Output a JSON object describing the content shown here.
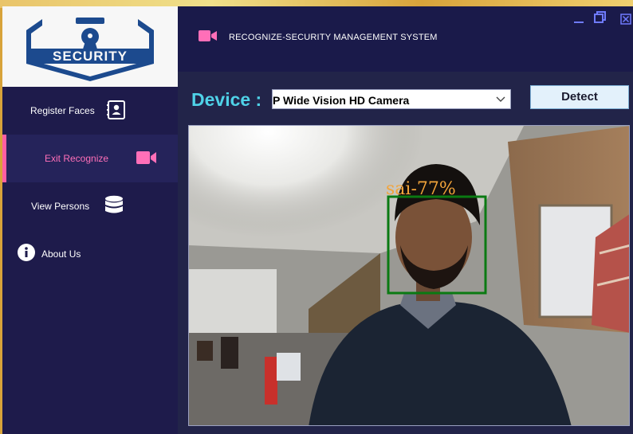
{
  "app": {
    "title": "RECOGNIZE-SECURITY MANAGEMENT SYSTEM",
    "logo_text": "SECURITY"
  },
  "sidebar": {
    "items": [
      {
        "label": "Register Faces",
        "icon": "contact-book-icon"
      },
      {
        "label": "Exit Recognize",
        "icon": "video-camera-icon",
        "active": true
      },
      {
        "label": "View Persons",
        "icon": "database-icon"
      },
      {
        "label": "About Us",
        "icon": "info-icon"
      }
    ]
  },
  "toolbar": {
    "device_label": "Device :",
    "device_value": "P Wide Vision HD Camera",
    "detect_label": "Detect"
  },
  "feed": {
    "recognition_label": "sai-77%"
  },
  "colors": {
    "accent_pink": "#ff5fa2",
    "device_label": "#4fd2e8",
    "sidebar_bg": "#1e1b4b",
    "face_box": "#0a7a12",
    "face_label": "#f2a43a"
  }
}
